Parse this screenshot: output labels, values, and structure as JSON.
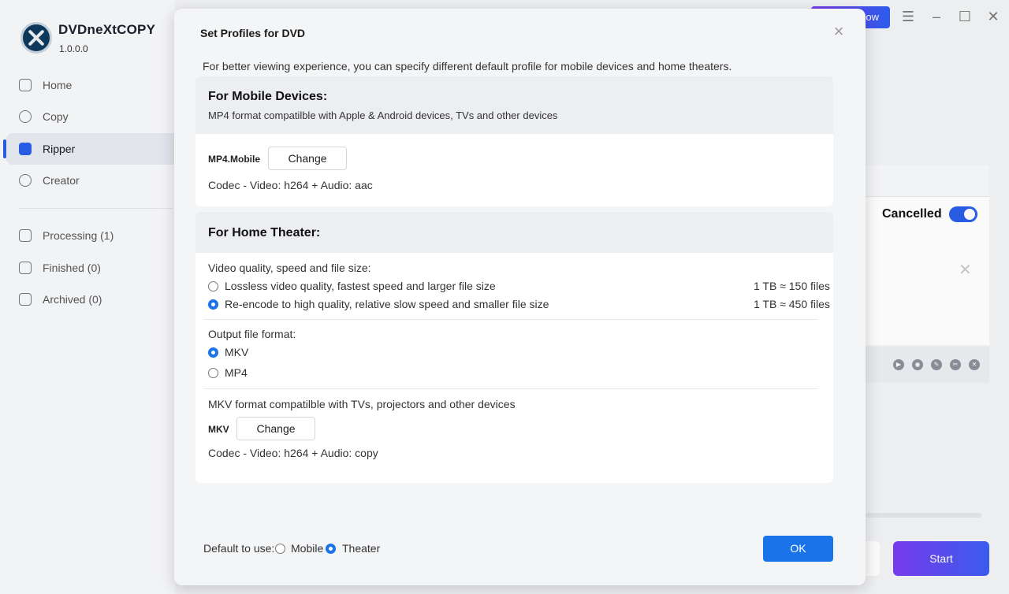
{
  "app": {
    "name": "DVDneXtCOPY",
    "version": "1.0.0.0",
    "top_button": "ow",
    "accent": "#2b5ee8"
  },
  "sidebar": {
    "items": [
      {
        "label": "Home",
        "icon": "home-icon"
      },
      {
        "label": "Copy",
        "icon": "copy-icon"
      },
      {
        "label": "Ripper",
        "icon": "ripper-icon"
      },
      {
        "label": "Creator",
        "icon": "creator-icon"
      },
      {
        "label": "Processing (1)",
        "icon": "processing-icon"
      },
      {
        "label": "Finished (0)",
        "icon": "finished-icon"
      },
      {
        "label": "Archived (0)",
        "icon": "archived-icon"
      }
    ],
    "active": "Ripper"
  },
  "background": {
    "status_label": "Cancelled",
    "start_label": "Start"
  },
  "dialog": {
    "title": "Set Profiles for DVD",
    "intro": "For better viewing experience, you can specify different default profile for mobile devices and home theaters.",
    "mobile": {
      "title": "For Mobile Devices:",
      "subtitle": "MP4 format compatilble with Apple & Android devices, TVs and other devices",
      "format_label": "MP4.Mobile",
      "change_label": "Change",
      "codec": "Codec - Video: h264 + Audio: aac"
    },
    "theater": {
      "title": "For Home Theater:",
      "quality_heading": "Video quality, speed and file size:",
      "quality_options": [
        {
          "label": "Lossless video quality, fastest speed and larger file size",
          "note": "1 TB ≈ 150 files",
          "selected": false
        },
        {
          "label": "Re-encode to high quality, relative slow speed and smaller file size",
          "note": "1 TB ≈ 450 files",
          "selected": true
        }
      ],
      "format_heading": "Output file format:",
      "format_options": [
        {
          "label": "MKV",
          "selected": true
        },
        {
          "label": "MP4",
          "selected": false
        }
      ],
      "format_desc": "MKV format compatilble with TVs, projectors and other devices",
      "format_label": "MKV",
      "change_label": "Change",
      "codec": "Codec - Video: h264 + Audio: copy"
    },
    "footer": {
      "default_label": "Default to use:",
      "options": [
        {
          "label": "Mobile",
          "selected": false
        },
        {
          "label": "Theater",
          "selected": true
        }
      ],
      "ok_label": "OK"
    }
  }
}
